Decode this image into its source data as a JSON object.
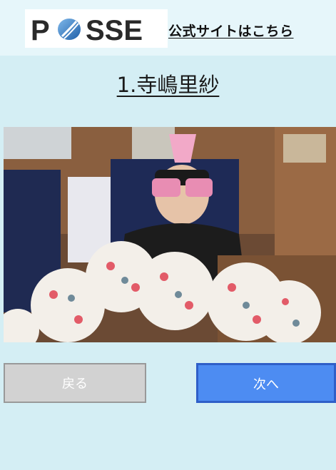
{
  "header": {
    "logo_text": "POSSE",
    "official_site_link": "公式サイトはこちら"
  },
  "main": {
    "title": "1.寺嶋里紗",
    "photo_icon": "photo-icon"
  },
  "nav": {
    "back_label": "戻る",
    "next_label": "次へ"
  },
  "colors": {
    "background": "#d4eef4",
    "next_button": "#4d8cf2",
    "back_button": "#d2d2d2"
  }
}
